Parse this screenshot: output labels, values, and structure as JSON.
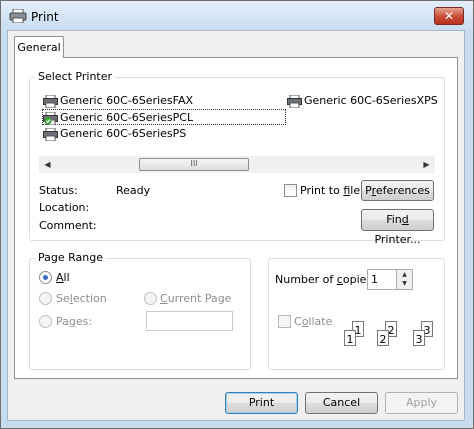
{
  "window": {
    "title": "Print",
    "close_icon": "✕"
  },
  "tabs": [
    "General"
  ],
  "select_printer": {
    "label": "Select Printer",
    "printers": [
      "Generic 60C-6SeriesFAX",
      "Generic 60C-6SeriesPCL",
      "Generic 60C-6SeriesPS",
      "Generic 60C-6SeriesXPS"
    ],
    "selected": "Generic 60C-6SeriesPCL",
    "scroll_thumb_grip": "III"
  },
  "status": {
    "status_label": "Status:",
    "status_value": "Ready",
    "location_label": "Location:",
    "location_value": "",
    "comment_label": "Comment:",
    "comment_value": ""
  },
  "print_to_file": {
    "label_pre": "Print to ",
    "label_u": "f",
    "label_post": "ile",
    "checked": false
  },
  "preferences_button": {
    "pre": "P",
    "u": "r",
    "post": "eferences"
  },
  "find_printer_button": {
    "pre": "Fin",
    "u": "d",
    "post": " Printer..."
  },
  "page_range": {
    "label": "Page Range",
    "all": {
      "pre": "",
      "u": "A",
      "post": "ll",
      "selected": true
    },
    "selection": {
      "pre": "Se",
      "u": "l",
      "post": "ection",
      "enabled": false
    },
    "current_page": {
      "pre": "",
      "u": "C",
      "post": "urrent Page",
      "enabled": false
    },
    "pages": {
      "pre": "Pa",
      "u": "g",
      "post": "es:",
      "enabled": false,
      "value": ""
    }
  },
  "copies": {
    "label_pre": "Number of ",
    "label_u": "c",
    "label_post": "opies:",
    "value": "1",
    "collate": {
      "pre": "C",
      "u": "o",
      "post": "llate",
      "checked": false,
      "enabled": false
    },
    "collate_pages": [
      [
        "1",
        "1"
      ],
      [
        "2",
        "2"
      ],
      [
        "3",
        "3"
      ]
    ]
  },
  "buttons": {
    "print": "Print",
    "cancel": "Cancel",
    "apply": "Apply"
  },
  "icons": {
    "printer": "printer-icon",
    "default_printer": "default-printer-icon",
    "scroll_left": "◀",
    "scroll_right": "▶",
    "spin_up": "▲",
    "spin_down": "▼"
  }
}
